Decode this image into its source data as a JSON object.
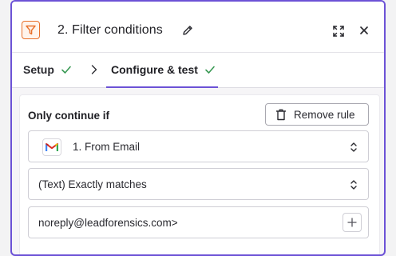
{
  "header": {
    "title": "2. Filter conditions",
    "step_icon": "filter-icon",
    "actions": [
      "pencil-icon",
      "expand-icon",
      "close-icon"
    ]
  },
  "tabs": [
    {
      "label": "Setup",
      "completed": true
    },
    {
      "label": "Configure & test",
      "completed": true,
      "active": true
    }
  ],
  "rule": {
    "label": "Only continue if",
    "remove_label": "Remove rule",
    "field_label": "1. From Email",
    "condition_label": "(Text) Exactly matches",
    "value": "noreply@leadforensics.com>"
  },
  "colors": {
    "accent": "#6c52d6",
    "step_icon": "#e8702a",
    "check": "#3a9a55"
  }
}
